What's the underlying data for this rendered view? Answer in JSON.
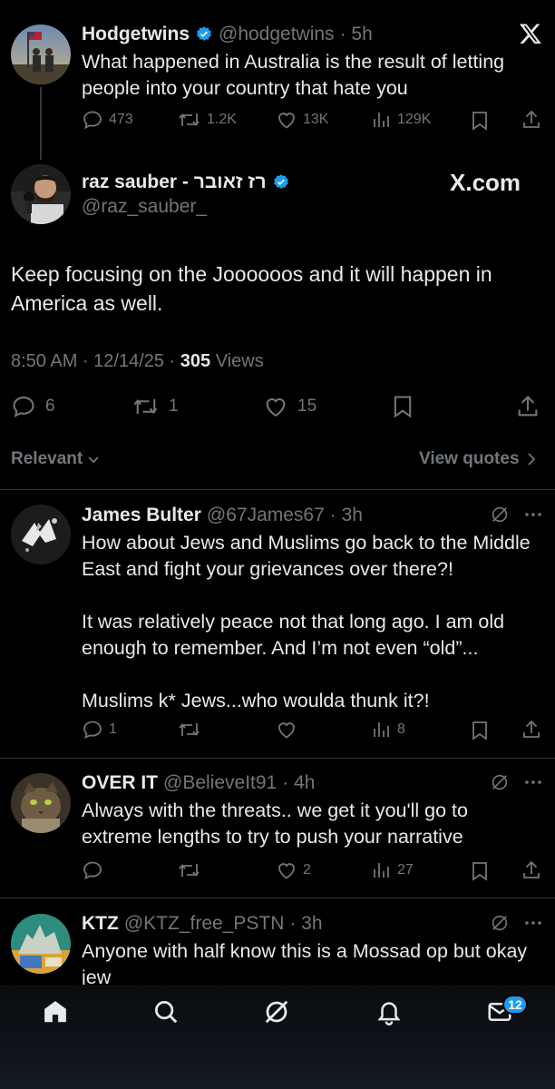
{
  "parent_tweet": {
    "name": "Hodgetwins",
    "handle": "@hodgetwins",
    "time": "· 5h",
    "text": "What happened in Australia is the result of letting people into your country that hate you",
    "replies": "473",
    "reposts": "1.2K",
    "likes": "13K",
    "views": "129K"
  },
  "main_tweet": {
    "name": "raz sauber - רז זאובר",
    "handle": "@raz_sauber_",
    "watermark": "X.com",
    "text": "Keep focusing on the Joooooos and it will happen in America as well.",
    "timestamp": "8:50 AM · 12/14/25 · ",
    "views_count": "305",
    "views_label": " Views",
    "replies": "6",
    "reposts": "1",
    "likes": "15"
  },
  "sort": {
    "label": "Relevant",
    "view_quotes": "View quotes"
  },
  "replies": [
    {
      "name": "James Bulter",
      "handle": "@67James67",
      "time": "· 3h",
      "text": "How about Jews and Muslims go back to the Middle East and fight your grievances over there?!\n\nIt was relatively peace not that long ago.  I am old enough to remember.  And I’m not even “old”...\n\nMuslims k* Jews...who woulda thunk it?!",
      "replies": "1",
      "reposts": "",
      "likes": "",
      "views": "8"
    },
    {
      "name": "OVER IT",
      "handle": "@BelieveIt91",
      "time": "· 4h",
      "text": "Always with the threats.. we get it you'll go to extreme lengths to try to push your narrative",
      "replies": "",
      "reposts": "",
      "likes": "2",
      "views": "27"
    },
    {
      "name": "KTZ",
      "handle": "@KTZ_free_PSTN",
      "time": "· 3h",
      "text": "Anyone with half know this is a Mossad op but okay jew"
    }
  ],
  "nav": {
    "messages_badge": "12"
  },
  "icons": {
    "x_logo": "x-logo-icon",
    "verified": "verified-badge-icon",
    "reply": "reply-icon",
    "repost": "repost-icon",
    "like": "heart-icon",
    "views": "views-icon",
    "bookmark": "bookmark-icon",
    "share": "share-icon",
    "grok": "grok-icon",
    "more": "more-icon"
  },
  "colors": {
    "background": "#000000",
    "text": "#e7e9ea",
    "muted": "#71767b",
    "accent": "#1d9bf0",
    "divider": "#2f3336"
  }
}
